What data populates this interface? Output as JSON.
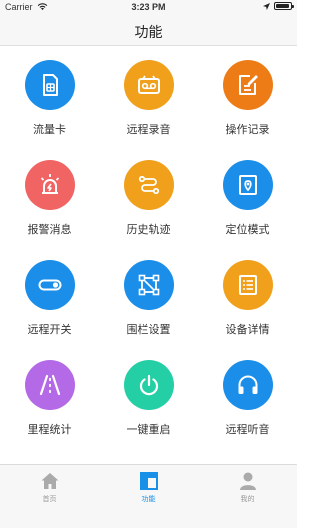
{
  "status": {
    "carrier": "Carrier",
    "time": "3:23 PM",
    "battery_level": 0.9
  },
  "nav": {
    "title": "功能"
  },
  "features": [
    {
      "label": "流量卡",
      "color": "#1a8ee9",
      "icon": "sim-card-icon"
    },
    {
      "label": "远程录音",
      "color": "#f0a01b",
      "icon": "recorder-icon"
    },
    {
      "label": "操作记录",
      "color": "#ee7c16",
      "icon": "edit-log-icon"
    },
    {
      "label": "报警消息",
      "color": "#f06463",
      "icon": "alarm-light-icon"
    },
    {
      "label": "历史轨迹",
      "color": "#f0a01b",
      "icon": "track-route-icon"
    },
    {
      "label": "定位模式",
      "color": "#1a8ee9",
      "icon": "location-pin-icon"
    },
    {
      "label": "远程开关",
      "color": "#1a8ee9",
      "icon": "toggle-switch-icon"
    },
    {
      "label": "围栏设置",
      "color": "#1a8ee9",
      "icon": "fence-icon"
    },
    {
      "label": "设备详情",
      "color": "#f0a01b",
      "icon": "device-details-icon"
    },
    {
      "label": "里程统计",
      "color": "#b46ae6",
      "icon": "road-mileage-icon"
    },
    {
      "label": "一键重启",
      "color": "#25cfa6",
      "icon": "power-icon"
    },
    {
      "label": "远程听音",
      "color": "#1a8ee9",
      "icon": "headphones-icon"
    }
  ],
  "tabs": [
    {
      "label": "首页",
      "icon": "home-icon",
      "active": false
    },
    {
      "label": "功能",
      "icon": "function-grid-icon",
      "active": true
    },
    {
      "label": "我的",
      "icon": "person-icon",
      "active": false
    }
  ],
  "colors": {
    "active_tab": "#1890e8",
    "inactive_tab": "#999999"
  }
}
